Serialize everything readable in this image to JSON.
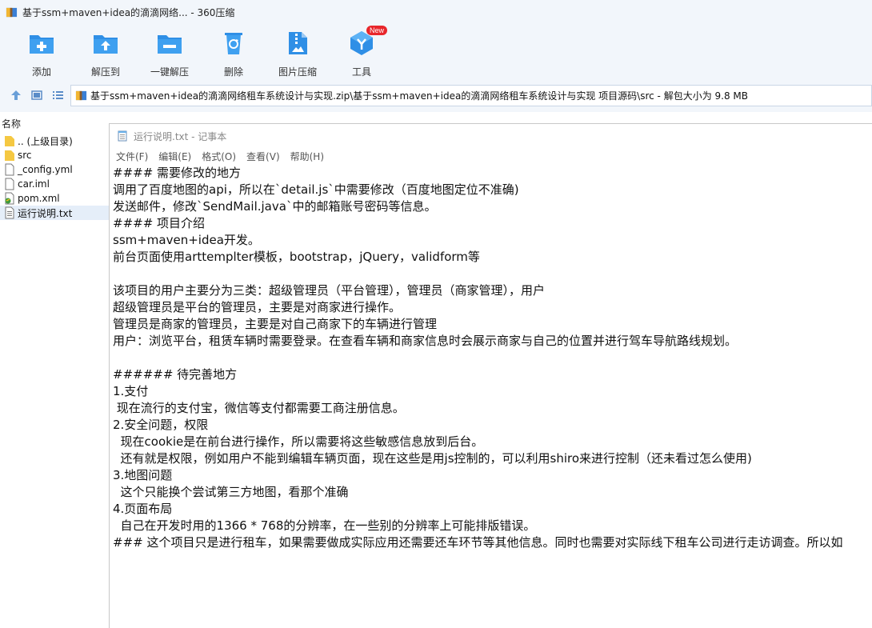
{
  "window": {
    "title": "基于ssm+maven+idea的滴滴网络... - 360压缩"
  },
  "toolbar": {
    "items": [
      {
        "label": "添加",
        "icon": "add-folder-icon"
      },
      {
        "label": "解压到",
        "icon": "extract-to-icon"
      },
      {
        "label": "一键解压",
        "icon": "one-click-extract-icon"
      },
      {
        "label": "删除",
        "icon": "recycle-delete-icon"
      },
      {
        "label": "图片压缩",
        "icon": "image-compress-icon"
      },
      {
        "label": "工具",
        "icon": "tools-icon",
        "badge": "New"
      }
    ]
  },
  "address": {
    "path": "基于ssm+maven+idea的滴滴网络租车系统设计与实现.zip\\基于ssm+maven+idea的滴滴网络租车系统设计与实现 项目源码\\src - 解包大小为 9.8 MB"
  },
  "filelist": {
    "column_header": "名称",
    "files": [
      {
        "name": ".. (上级目录)",
        "icon": "folder-up-icon"
      },
      {
        "name": "src",
        "icon": "folder-icon"
      },
      {
        "name": "_config.yml",
        "icon": "file-icon"
      },
      {
        "name": "car.iml",
        "icon": "file-icon"
      },
      {
        "name": "pom.xml",
        "icon": "xml-file-icon"
      },
      {
        "name": "运行说明.txt",
        "icon": "text-file-icon",
        "selected": true
      }
    ]
  },
  "notepad": {
    "title": "运行说明.txt - 记事本",
    "menu": [
      "文件(F)",
      "编辑(E)",
      "格式(O)",
      "查看(V)",
      "帮助(H)"
    ],
    "lines": [
      "#### 需要修改的地方",
      "调用了百度地图的api，所以在`detail.js`中需要修改（百度地图定位不准确)",
      "发送邮件，修改`SendMail.java`中的邮箱账号密码等信息。",
      "#### 项目介绍",
      "ssm+maven+idea开发。",
      "前台页面使用arttemplter模板，bootstrap，jQuery，validform等",
      "",
      "该项目的用户主要分为三类：超级管理员（平台管理），管理员（商家管理），用户",
      "超级管理员是平台的管理员，主要是对商家进行操作。",
      "管理员是商家的管理员，主要是对自己商家下的车辆进行管理",
      "用户：浏览平台，租赁车辆时需要登录。在查看车辆和商家信息时会展示商家与自己的位置并进行驾车导航路线规划。",
      "",
      "###### 待完善地方",
      "1.支付",
      " 现在流行的支付宝，微信等支付都需要工商注册信息。",
      "2.安全问题，权限",
      "  现在cookie是在前台进行操作，所以需要将这些敏感信息放到后台。",
      "  还有就是权限，例如用户不能到编辑车辆页面，现在这些是用js控制的，可以利用shiro来进行控制（还未看过怎么使用)",
      "3.地图问题",
      "  这个只能换个尝试第三方地图，看那个准确",
      "4.页面布局",
      "  自己在开发时用的1366 * 768的分辨率，在一些别的分辨率上可能排版错误。",
      "### 这个项目只是进行租车，如果需要做成实际应用还需要还车环节等其他信息。同时也需要对实际线下租车公司进行走访调查。所以如"
    ]
  }
}
